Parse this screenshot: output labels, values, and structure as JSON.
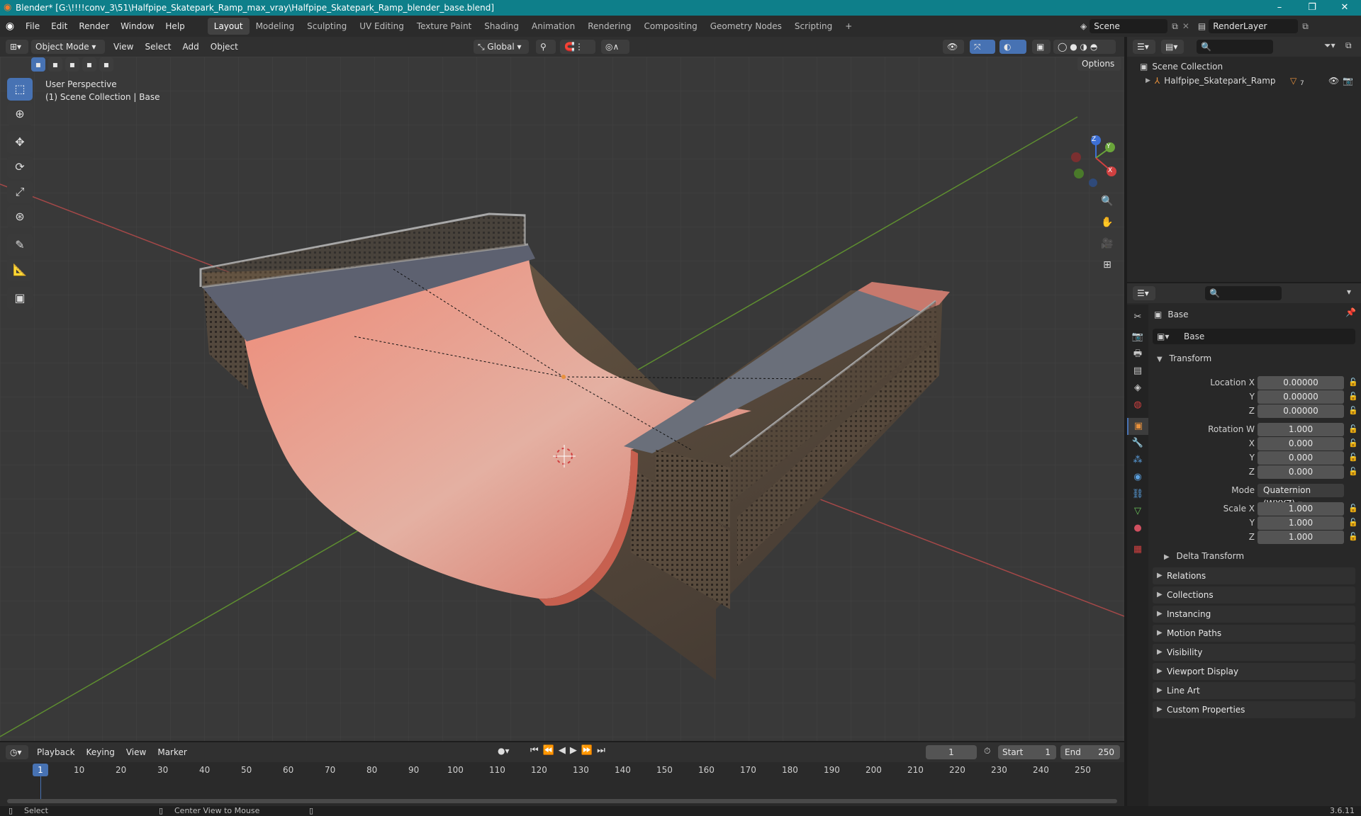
{
  "window": {
    "title": "Blender* [G:\\!!!!conv_3\\51\\Halfpipe_Skatepark_Ramp_max_vray\\Halfpipe_Skatepark_Ramp_blender_base.blend]",
    "minimize": "–",
    "maximize": "❐",
    "close": "✕"
  },
  "menu": {
    "items": [
      "File",
      "Edit",
      "Render",
      "Window",
      "Help"
    ]
  },
  "workspaces": [
    "Layout",
    "Modeling",
    "Sculpting",
    "UV Editing",
    "Texture Paint",
    "Shading",
    "Animation",
    "Rendering",
    "Compositing",
    "Geometry Nodes",
    "Scripting"
  ],
  "workspace_add": "+",
  "scene": {
    "name": "Scene",
    "render_layer": "RenderLayer"
  },
  "viewport_header": {
    "mode": "Object Mode",
    "view": "View",
    "select": "Select",
    "add": "Add",
    "object": "Object",
    "orientation": "Global",
    "options": "Options"
  },
  "viewport": {
    "perspective": "User Perspective",
    "collection": "(1) Scene Collection | Base"
  },
  "gizmo": {
    "z": "Z",
    "y": "Y",
    "x": "X"
  },
  "outliner": {
    "scene_collection": "Scene Collection",
    "object": "Halfpipe_Skatepark_Ramp",
    "object_badge": "7"
  },
  "properties": {
    "object_name": "Base",
    "data_name": "Base",
    "transform_label": "Transform",
    "location": {
      "label_x": "Location X",
      "label_y": "Y",
      "label_z": "Z",
      "x": "0.00000",
      "y": "0.00000",
      "z": "0.00000"
    },
    "rotation": {
      "label_w": "Rotation W",
      "label_x": "X",
      "label_y": "Y",
      "label_z": "Z",
      "w": "1.000",
      "x": "0.000",
      "y": "0.000",
      "z": "0.000"
    },
    "mode_label": "Mode",
    "mode_value": "Quaternion (WXYZ)",
    "scale": {
      "label_x": "Scale X",
      "label_y": "Y",
      "label_z": "Z",
      "x": "1.000",
      "y": "1.000",
      "z": "1.000"
    },
    "delta_transform": "Delta Transform",
    "panels": [
      "Relations",
      "Collections",
      "Instancing",
      "Motion Paths",
      "Visibility",
      "Viewport Display",
      "Line Art",
      "Custom Properties"
    ]
  },
  "timeline": {
    "playback": "Playback",
    "keying": "Keying",
    "view": "View",
    "marker": "Marker",
    "current_frame": "1",
    "start_label": "Start",
    "start": "1",
    "end_label": "End",
    "end": "250",
    "cursor_frame": "1",
    "ticks": [
      "10",
      "20",
      "30",
      "40",
      "50",
      "60",
      "70",
      "80",
      "90",
      "100",
      "110",
      "120",
      "130",
      "140",
      "150",
      "160",
      "170",
      "180",
      "190",
      "200",
      "210",
      "220",
      "230",
      "240",
      "250"
    ]
  },
  "status": {
    "select": "Select",
    "center_view": "Center View to Mouse",
    "version": "3.6.11"
  },
  "colors": {
    "accent": "#4772b3",
    "title_bar": "#0e7f8a",
    "ramp_surface": "#e07a6a",
    "grid_x": "#b04a4a",
    "grid_y": "#6a9a35",
    "object_orange": "#e8913c"
  }
}
